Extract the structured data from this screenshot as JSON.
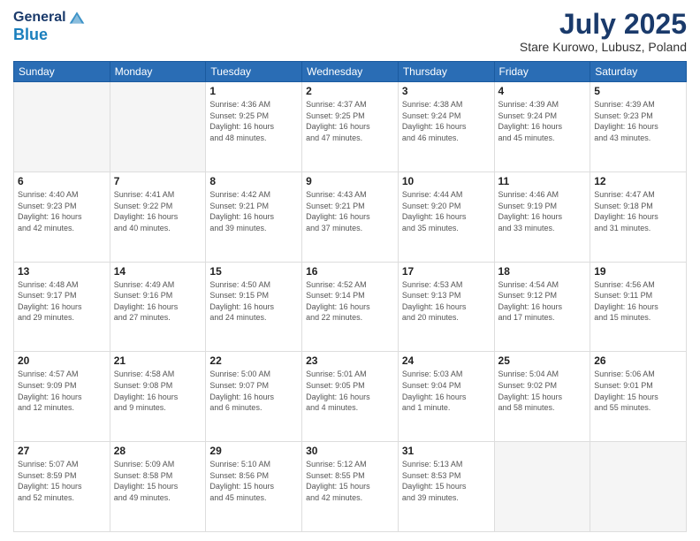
{
  "header": {
    "logo_line1": "General",
    "logo_line2": "Blue",
    "main_title": "July 2025",
    "subtitle": "Stare Kurowo, Lubusz, Poland"
  },
  "days_of_week": [
    "Sunday",
    "Monday",
    "Tuesday",
    "Wednesday",
    "Thursday",
    "Friday",
    "Saturday"
  ],
  "weeks": [
    [
      {
        "day": "",
        "info": ""
      },
      {
        "day": "",
        "info": ""
      },
      {
        "day": "1",
        "info": "Sunrise: 4:36 AM\nSunset: 9:25 PM\nDaylight: 16 hours\nand 48 minutes."
      },
      {
        "day": "2",
        "info": "Sunrise: 4:37 AM\nSunset: 9:25 PM\nDaylight: 16 hours\nand 47 minutes."
      },
      {
        "day": "3",
        "info": "Sunrise: 4:38 AM\nSunset: 9:24 PM\nDaylight: 16 hours\nand 46 minutes."
      },
      {
        "day": "4",
        "info": "Sunrise: 4:39 AM\nSunset: 9:24 PM\nDaylight: 16 hours\nand 45 minutes."
      },
      {
        "day": "5",
        "info": "Sunrise: 4:39 AM\nSunset: 9:23 PM\nDaylight: 16 hours\nand 43 minutes."
      }
    ],
    [
      {
        "day": "6",
        "info": "Sunrise: 4:40 AM\nSunset: 9:23 PM\nDaylight: 16 hours\nand 42 minutes."
      },
      {
        "day": "7",
        "info": "Sunrise: 4:41 AM\nSunset: 9:22 PM\nDaylight: 16 hours\nand 40 minutes."
      },
      {
        "day": "8",
        "info": "Sunrise: 4:42 AM\nSunset: 9:21 PM\nDaylight: 16 hours\nand 39 minutes."
      },
      {
        "day": "9",
        "info": "Sunrise: 4:43 AM\nSunset: 9:21 PM\nDaylight: 16 hours\nand 37 minutes."
      },
      {
        "day": "10",
        "info": "Sunrise: 4:44 AM\nSunset: 9:20 PM\nDaylight: 16 hours\nand 35 minutes."
      },
      {
        "day": "11",
        "info": "Sunrise: 4:46 AM\nSunset: 9:19 PM\nDaylight: 16 hours\nand 33 minutes."
      },
      {
        "day": "12",
        "info": "Sunrise: 4:47 AM\nSunset: 9:18 PM\nDaylight: 16 hours\nand 31 minutes."
      }
    ],
    [
      {
        "day": "13",
        "info": "Sunrise: 4:48 AM\nSunset: 9:17 PM\nDaylight: 16 hours\nand 29 minutes."
      },
      {
        "day": "14",
        "info": "Sunrise: 4:49 AM\nSunset: 9:16 PM\nDaylight: 16 hours\nand 27 minutes."
      },
      {
        "day": "15",
        "info": "Sunrise: 4:50 AM\nSunset: 9:15 PM\nDaylight: 16 hours\nand 24 minutes."
      },
      {
        "day": "16",
        "info": "Sunrise: 4:52 AM\nSunset: 9:14 PM\nDaylight: 16 hours\nand 22 minutes."
      },
      {
        "day": "17",
        "info": "Sunrise: 4:53 AM\nSunset: 9:13 PM\nDaylight: 16 hours\nand 20 minutes."
      },
      {
        "day": "18",
        "info": "Sunrise: 4:54 AM\nSunset: 9:12 PM\nDaylight: 16 hours\nand 17 minutes."
      },
      {
        "day": "19",
        "info": "Sunrise: 4:56 AM\nSunset: 9:11 PM\nDaylight: 16 hours\nand 15 minutes."
      }
    ],
    [
      {
        "day": "20",
        "info": "Sunrise: 4:57 AM\nSunset: 9:09 PM\nDaylight: 16 hours\nand 12 minutes."
      },
      {
        "day": "21",
        "info": "Sunrise: 4:58 AM\nSunset: 9:08 PM\nDaylight: 16 hours\nand 9 minutes."
      },
      {
        "day": "22",
        "info": "Sunrise: 5:00 AM\nSunset: 9:07 PM\nDaylight: 16 hours\nand 6 minutes."
      },
      {
        "day": "23",
        "info": "Sunrise: 5:01 AM\nSunset: 9:05 PM\nDaylight: 16 hours\nand 4 minutes."
      },
      {
        "day": "24",
        "info": "Sunrise: 5:03 AM\nSunset: 9:04 PM\nDaylight: 16 hours\nand 1 minute."
      },
      {
        "day": "25",
        "info": "Sunrise: 5:04 AM\nSunset: 9:02 PM\nDaylight: 15 hours\nand 58 minutes."
      },
      {
        "day": "26",
        "info": "Sunrise: 5:06 AM\nSunset: 9:01 PM\nDaylight: 15 hours\nand 55 minutes."
      }
    ],
    [
      {
        "day": "27",
        "info": "Sunrise: 5:07 AM\nSunset: 8:59 PM\nDaylight: 15 hours\nand 52 minutes."
      },
      {
        "day": "28",
        "info": "Sunrise: 5:09 AM\nSunset: 8:58 PM\nDaylight: 15 hours\nand 49 minutes."
      },
      {
        "day": "29",
        "info": "Sunrise: 5:10 AM\nSunset: 8:56 PM\nDaylight: 15 hours\nand 45 minutes."
      },
      {
        "day": "30",
        "info": "Sunrise: 5:12 AM\nSunset: 8:55 PM\nDaylight: 15 hours\nand 42 minutes."
      },
      {
        "day": "31",
        "info": "Sunrise: 5:13 AM\nSunset: 8:53 PM\nDaylight: 15 hours\nand 39 minutes."
      },
      {
        "day": "",
        "info": ""
      },
      {
        "day": "",
        "info": ""
      }
    ]
  ]
}
